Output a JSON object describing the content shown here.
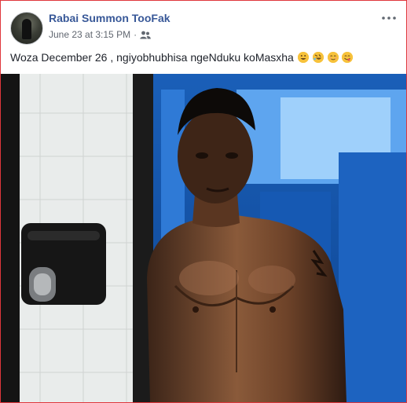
{
  "post": {
    "author": "Rabai Summon TooFak",
    "date": "June 23 at 3:15 PM",
    "separator": "·",
    "text": "Woza December 26 , ngiyobhubhisa ngeNduku koMasxha",
    "emojis": [
      "grinning-face",
      "rolling-on-floor-laughing",
      "relieved-face",
      "face-savoring-food"
    ]
  },
  "icons": {
    "audience": "friends-icon",
    "more": "more-options-icon"
  },
  "colors": {
    "author_link": "#385898",
    "meta_text": "#616770",
    "body_text": "#1d2129",
    "frame_border": "#e0373c"
  }
}
